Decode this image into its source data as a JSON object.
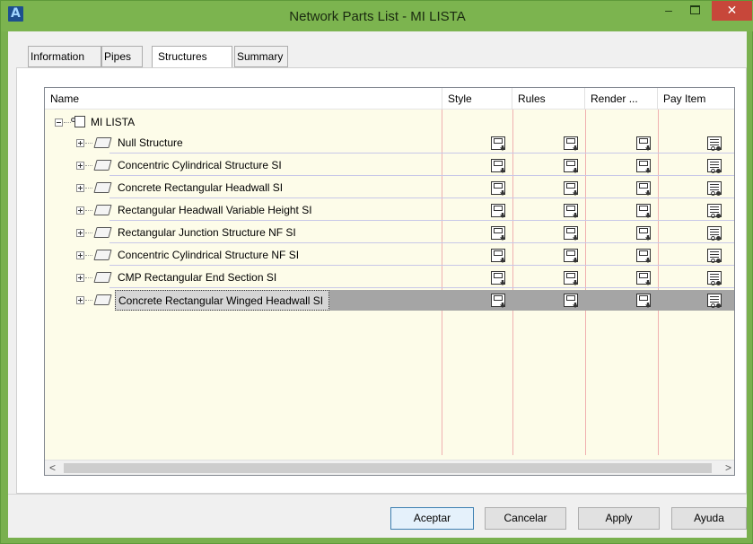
{
  "window": {
    "title": "Network Parts List - MI LISTA",
    "min_glyph": "–",
    "close_glyph": "✕"
  },
  "tabs": [
    {
      "label": "Information"
    },
    {
      "label": "Pipes"
    },
    {
      "label": "Structures",
      "active": true
    },
    {
      "label": "Summary"
    }
  ],
  "columns": [
    "Name",
    "Style",
    "Rules",
    "Render ...",
    "Pay Item"
  ],
  "tree": {
    "root_label": "MI LISTA",
    "items": [
      {
        "label": "Null Structure"
      },
      {
        "label": "Concentric Cylindrical Structure SI"
      },
      {
        "label": "Concrete Rectangular Headwall SI"
      },
      {
        "label": "Rectangular Headwall Variable Height SI"
      },
      {
        "label": "Rectangular Junction Structure NF SI"
      },
      {
        "label": "Concentric Cylindrical Structure NF SI"
      },
      {
        "label": "CMP Rectangular End Section SI"
      },
      {
        "label": "Concrete Rectangular Winged Headwall SI",
        "selected": true
      }
    ]
  },
  "scroll": {
    "left": "<",
    "right": ">"
  },
  "buttons": {
    "accept": "Aceptar",
    "cancel": "Cancelar",
    "apply": "Apply",
    "help": "Ayuda"
  },
  "colors": {
    "title_bar": "#7cb44f",
    "list_bg": "#fdfce9",
    "selected_row": "#a5a5a5",
    "close_button": "#c7473a"
  },
  "icons": {
    "cell": "save-disk-icon",
    "pay_item": "pay-item-icon",
    "folder": "folder-icon"
  }
}
